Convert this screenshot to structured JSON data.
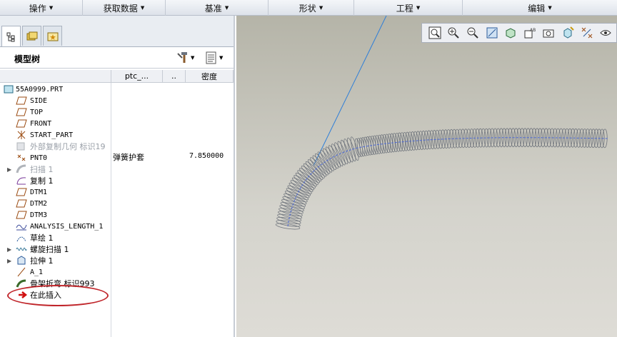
{
  "menubar": {
    "items": [
      "操作",
      "获取数据",
      "基准",
      "形状",
      "工程",
      "编辑"
    ]
  },
  "tabs": [
    "model-tree-tab",
    "layers-tab",
    "favorites-tab"
  ],
  "tree_header": {
    "title": "模型树",
    "settings_icon": "tools-icon",
    "show_icon": "list-icon"
  },
  "columns": {
    "col1": "ptc_...",
    "col2": "..",
    "col3": "密度"
  },
  "tree": {
    "rows": [
      {
        "label": "55A0999.PRT",
        "c1": "弹簧护套",
        "c3": "7.850000"
      },
      {
        "label": "SIDE"
      },
      {
        "label": "TOP"
      },
      {
        "label": "FRONT"
      },
      {
        "label": "START_PART"
      },
      {
        "label": "外部复制几何 标识19"
      },
      {
        "label": "PNT0"
      },
      {
        "label": "扫描 1"
      },
      {
        "label": "复制 1"
      },
      {
        "label": "DTM1"
      },
      {
        "label": "DTM2"
      },
      {
        "label": "DTM3"
      },
      {
        "label": "ANALYSIS_LENGTH_1"
      },
      {
        "label": "草绘 1"
      },
      {
        "label": "螺旋扫描 1"
      },
      {
        "label": "拉伸 1"
      },
      {
        "label": "A_1"
      },
      {
        "label": "骨架折弯 标识993"
      },
      {
        "label": "在此插入"
      }
    ]
  },
  "colors": {
    "menubar": "#dde2ea",
    "viewport_bg": "#d4d3cc",
    "spring": "#6f747c",
    "axis_line": "#2f7fd8",
    "highlight": "#c0262b"
  }
}
